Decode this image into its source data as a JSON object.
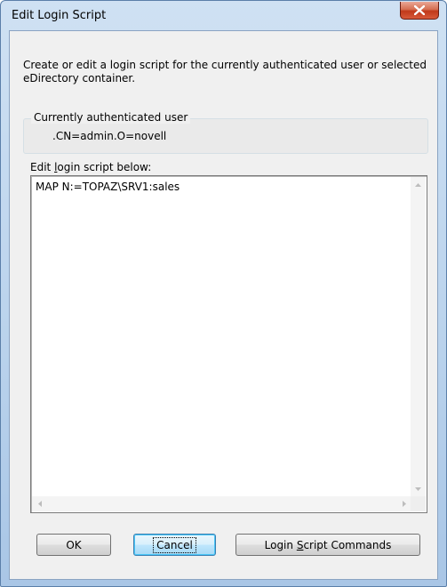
{
  "window": {
    "title": "Edit Login Script",
    "close_label": "Close"
  },
  "description": {
    "line1": "Create or edit a login script for the currently authenticated user or selected",
    "line2": "eDirectory container."
  },
  "current_user": {
    "group_label": "Currently authenticated user",
    "value": ".CN=admin.O=novell"
  },
  "script": {
    "label_prefix": "Edit ",
    "label_accel": "l",
    "label_suffix": "ogin script below:",
    "content": "MAP N:=TOPAZ\\SRV1:sales"
  },
  "buttons": {
    "ok": "OK",
    "cancel": "Cancel",
    "commands_prefix": "Login ",
    "commands_accel": "S",
    "commands_suffix": "cript Commands"
  },
  "icons": {
    "close": "close-x-icon",
    "scroll_up": "arrow-up-icon",
    "scroll_down": "arrow-down-icon",
    "scroll_left": "arrow-left-icon",
    "scroll_right": "arrow-right-icon"
  },
  "colors": {
    "close_button": "#c0391a",
    "default_button_border": "#3c7fb1",
    "window_frame": "#b9d2ec"
  }
}
